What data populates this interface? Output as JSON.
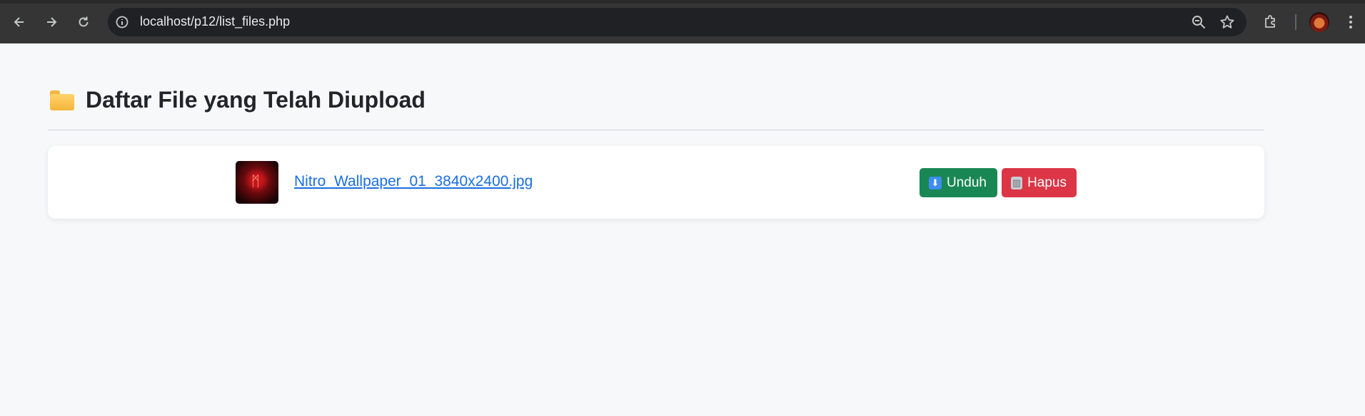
{
  "browser": {
    "url": "localhost/p12/list_files.php"
  },
  "page": {
    "title": "Daftar File yang Telah Diupload"
  },
  "files": [
    {
      "name": "Nitro_Wallpaper_01_3840x2400.jpg",
      "download_label": "Unduh",
      "delete_label": "Hapus"
    }
  ],
  "colors": {
    "download": "#198754",
    "delete": "#dc3545",
    "link": "#1a6ee0"
  },
  "icons": {
    "heading": "folder-icon",
    "download": "arrow-down-icon",
    "delete": "wastebasket-icon"
  }
}
